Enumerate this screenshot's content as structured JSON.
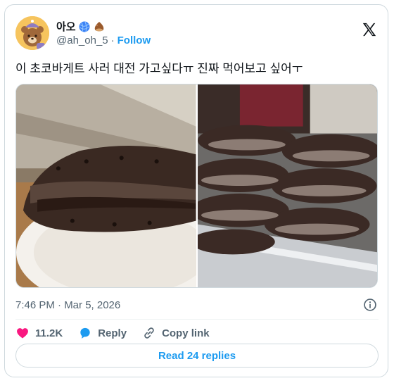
{
  "author": {
    "display_name": "아오",
    "display_emojis": [
      "yarn-ball-emoji",
      "chestnut-emoji"
    ],
    "handle": "@ah_oh_5",
    "separator": "·",
    "follow_label": "Follow"
  },
  "tweet": {
    "text": "이 초코바게트 사러 대전 가고싶다ㅠ 진짜 먹어보고 싶어ㅜ",
    "media": [
      {
        "name": "chocolate-baguette-plate-photo"
      },
      {
        "name": "chocolate-baguettes-tray-photo"
      }
    ],
    "timestamp": "7:46 PM · Mar 5, 2026"
  },
  "actions": {
    "like_count": "11.2K",
    "reply_label": "Reply",
    "copy_link_label": "Copy link"
  },
  "read_replies_label": "Read 24 replies",
  "colors": {
    "accent": "#1d9bf0",
    "like": "#f91880",
    "text": "#0f1419",
    "muted": "#536471",
    "border": "#cfd9de"
  }
}
